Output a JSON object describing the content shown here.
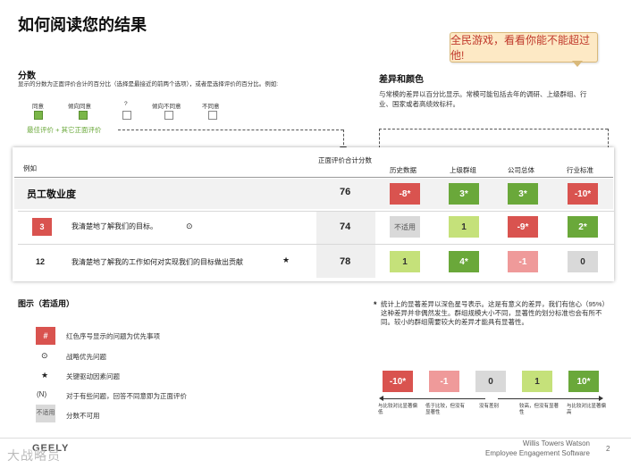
{
  "page": {
    "title": "如何阅读您的结果",
    "page_number": "2"
  },
  "callout": {
    "text": "全民游戏，看看你能不能超过他!"
  },
  "score_section": {
    "heading": "分数",
    "desc": "显示的分数为正面评价合计的百分比（选择是最接近的前两个选项），或者是选择评价的百分比。例如:",
    "scale": [
      "同意",
      "倾向同意",
      "?",
      "倾向不同意",
      "不同意"
    ],
    "note": "最佳评价 + 其它正面评价"
  },
  "diff_section": {
    "heading": "差异和颜色",
    "desc": "与常模的差异以百分比显示。常模可能包括去年的调研、上级群组、行业、国家或者高绩效标杆。"
  },
  "table": {
    "example_label": "例如",
    "headers": {
      "score": "正面评价合计分数",
      "history": "历史数据",
      "parent": "上级群组",
      "company": "公司总体",
      "industry": "行业标准"
    },
    "rows": [
      {
        "id": "",
        "label": "员工敬业度",
        "icon": "",
        "score": "76",
        "values": [
          "-8*",
          "3*",
          "3*",
          "-10*"
        ]
      },
      {
        "id": "3",
        "label": "我清楚地了解我们的目标。",
        "icon": "strategy-icon",
        "score": "74",
        "values": [
          "不适用",
          "1",
          "-9*",
          "2*"
        ]
      },
      {
        "id": "12",
        "label": "我清楚地了解我的工作如何对实现我们的目标做出贡献",
        "icon": "star-icon",
        "score": "78",
        "values": [
          "1",
          "4*",
          "-1",
          "0"
        ]
      }
    ]
  },
  "legend": {
    "heading": "图示（若适用）",
    "items": [
      {
        "symbol": "#",
        "text": "红色序号显示的问题为优先事项"
      },
      {
        "symbol": "⊙",
        "text": "战略优先问题"
      },
      {
        "symbol": "★",
        "text": "关键驱动因素问题"
      },
      {
        "symbol": "(N)",
        "text": "对于有些问题，回答不同意即为正面评价"
      },
      {
        "symbol": "不适用",
        "text": "分数不可用"
      }
    ]
  },
  "significance": {
    "marker": "*",
    "text": "统计上的显著差异以深色星号表示。这是有意义的差异，我们有信心（95%）这种差异并非偶然发生。群组规模大小不同，显著性的划分标准也会有所不同。较小的群组需要较大的差异才能具有显著性。"
  },
  "scale_bar": {
    "values": [
      "-10*",
      "-1",
      "0",
      "1",
      "10*"
    ],
    "captions": [
      "与比较对比显著偏低",
      "低于比较，但没有显著性",
      "没有差别",
      "较高，但没有显著性",
      "与比较对比显著偏高"
    ]
  },
  "footer": {
    "company": "Willis Towers Watson",
    "product": "Employee Engagement Software",
    "logo": "GEELY",
    "watermark": "大战略员"
  },
  "colors": {
    "red": "#d9534f",
    "pink": "#ef9a9a",
    "light_green": "#c5e17a",
    "dark_green": "#6aa83a",
    "gray": "#d9d9d9"
  }
}
